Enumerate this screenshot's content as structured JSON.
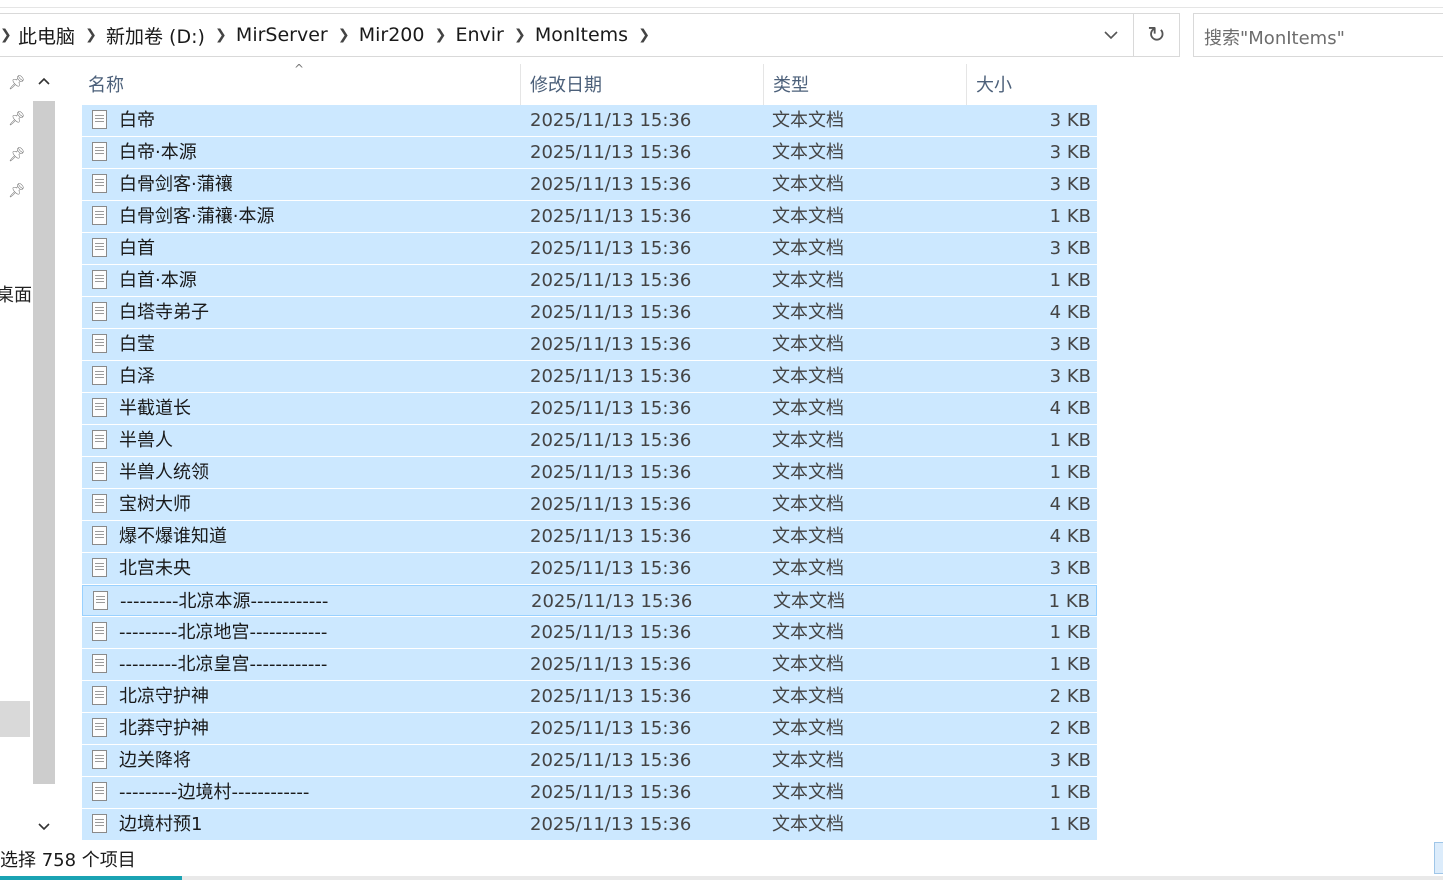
{
  "address_bar": {
    "breadcrumbs": [
      "此电脑",
      "新加卷 (D:)",
      "MirServer",
      "Mir200",
      "Envir",
      "MonItems"
    ]
  },
  "search": {
    "placeholder": "搜索\"MonItems\""
  },
  "nav_pane": {
    "partial_label": "桌面",
    "pinned_count": 4
  },
  "columns": {
    "name": "名称",
    "date": "修改日期",
    "type": "类型",
    "size": "大小"
  },
  "files": [
    {
      "name": "白帝",
      "date": "2025/11/13 15:36",
      "type": "文本文档",
      "size": "3 KB"
    },
    {
      "name": "白帝·本源",
      "date": "2025/11/13 15:36",
      "type": "文本文档",
      "size": "3 KB"
    },
    {
      "name": "白骨剑客·蒲禳",
      "date": "2025/11/13 15:36",
      "type": "文本文档",
      "size": "3 KB"
    },
    {
      "name": "白骨剑客·蒲禳·本源",
      "date": "2025/11/13 15:36",
      "type": "文本文档",
      "size": "1 KB"
    },
    {
      "name": "白首",
      "date": "2025/11/13 15:36",
      "type": "文本文档",
      "size": "3 KB"
    },
    {
      "name": "白首·本源",
      "date": "2025/11/13 15:36",
      "type": "文本文档",
      "size": "1 KB"
    },
    {
      "name": "白塔寺弟子",
      "date": "2025/11/13 15:36",
      "type": "文本文档",
      "size": "4 KB"
    },
    {
      "name": "白莹",
      "date": "2025/11/13 15:36",
      "type": "文本文档",
      "size": "3 KB"
    },
    {
      "name": "白泽",
      "date": "2025/11/13 15:36",
      "type": "文本文档",
      "size": "3 KB"
    },
    {
      "name": "半截道长",
      "date": "2025/11/13 15:36",
      "type": "文本文档",
      "size": "4 KB"
    },
    {
      "name": "半兽人",
      "date": "2025/11/13 15:36",
      "type": "文本文档",
      "size": "1 KB"
    },
    {
      "name": "半兽人统领",
      "date": "2025/11/13 15:36",
      "type": "文本文档",
      "size": "1 KB"
    },
    {
      "name": "宝树大师",
      "date": "2025/11/13 15:36",
      "type": "文本文档",
      "size": "4 KB"
    },
    {
      "name": "爆不爆谁知道",
      "date": "2025/11/13 15:36",
      "type": "文本文档",
      "size": "4 KB"
    },
    {
      "name": "北宫未央",
      "date": "2025/11/13 15:36",
      "type": "文本文档",
      "size": "3 KB"
    },
    {
      "name": "---------北凉本源------------",
      "date": "2025/11/13 15:36",
      "type": "文本文档",
      "size": "1 KB",
      "focused": true
    },
    {
      "name": "---------北凉地宫------------",
      "date": "2025/11/13 15:36",
      "type": "文本文档",
      "size": "1 KB"
    },
    {
      "name": "---------北凉皇宫------------",
      "date": "2025/11/13 15:36",
      "type": "文本文档",
      "size": "1 KB"
    },
    {
      "name": "北凉守护神",
      "date": "2025/11/13 15:36",
      "type": "文本文档",
      "size": "2 KB"
    },
    {
      "name": "北莽守护神",
      "date": "2025/11/13 15:36",
      "type": "文本文档",
      "size": "2 KB"
    },
    {
      "name": "边关降将",
      "date": "2025/11/13 15:36",
      "type": "文本文档",
      "size": "3 KB"
    },
    {
      "name": "---------边境村------------",
      "date": "2025/11/13 15:36",
      "type": "文本文档",
      "size": "1 KB"
    },
    {
      "name": "边境村预1",
      "date": "2025/11/13 15:36",
      "type": "文本文档",
      "size": "1 KB"
    }
  ],
  "status": {
    "text": "选择 758 个项目"
  },
  "colors": {
    "selected_row": "#cce8ff",
    "focus_border": "#99d1ff",
    "header_text": "#4c607a"
  }
}
